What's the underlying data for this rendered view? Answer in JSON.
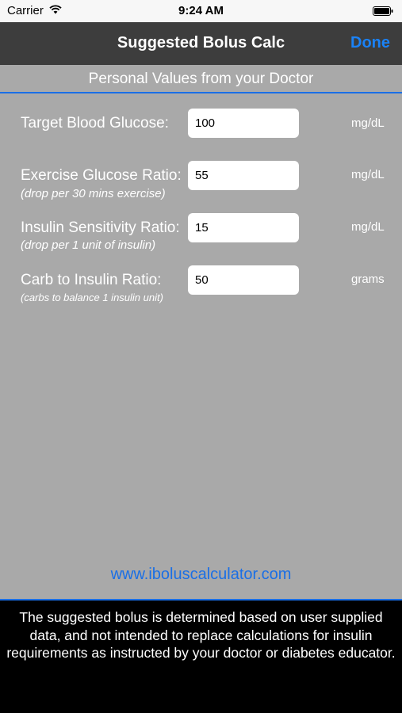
{
  "status_bar": {
    "carrier": "Carrier",
    "time": "9:24 AM",
    "icons": [
      "wifi-icon",
      "battery-icon"
    ]
  },
  "nav": {
    "title": "Suggested Bolus Calc",
    "done_label": "Done"
  },
  "section": {
    "title": "Personal Values from your Doctor"
  },
  "fields": [
    {
      "label": "Target Blood Glucose:",
      "hint": "",
      "value": "100",
      "unit": "mg/dL"
    },
    {
      "label": "Exercise Glucose Ratio:",
      "hint": "(drop per 30 mins exercise)",
      "value": "55",
      "unit": "mg/dL"
    },
    {
      "label": "Insulin Sensitivity Ratio:",
      "hint": "(drop per 1 unit of insulin)",
      "value": "15",
      "unit": "mg/dL"
    },
    {
      "label": "Carb to Insulin Ratio:",
      "hint": "(carbs to balance 1 insulin unit)",
      "value": "50",
      "unit": "grams"
    }
  ],
  "website": "www.iboluscalculator.com",
  "disclaimer": "The suggested bolus is determined based on user supplied data, and not intended to replace calculations for insulin requirements as instructed by your doctor or diabetes educator.",
  "colors": {
    "accent": "#1a6fe6",
    "done": "#1a82f7",
    "background": "#a9a9a9",
    "nav_bar": "#3d3d3d"
  }
}
